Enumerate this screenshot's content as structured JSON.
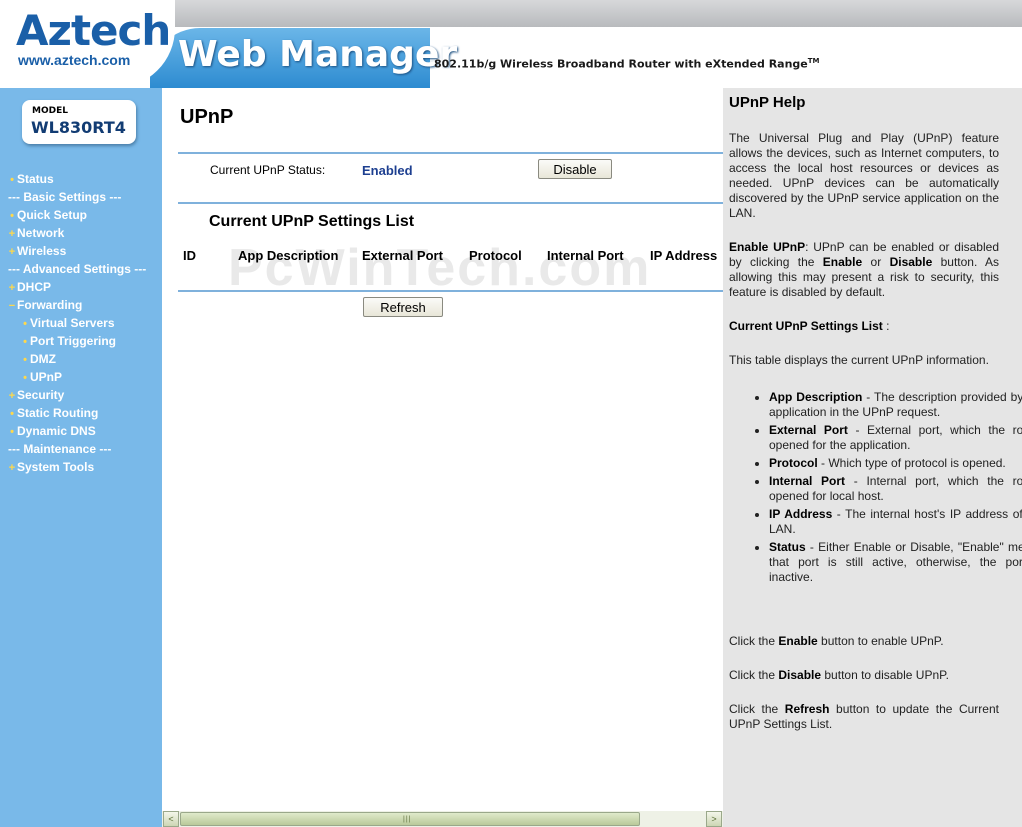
{
  "header": {
    "logo": "Aztech",
    "logo_url": "www.aztech.com",
    "title": "Web Manager",
    "subtitle": "802.11b/g Wireless Broadband Router with eXtended Range",
    "trademark": "TM"
  },
  "sidebar": {
    "model_label": "MODEL",
    "model_name": "WL830RT4",
    "items": [
      {
        "label": "Status",
        "bullet": "•",
        "level": "l1"
      },
      {
        "label": "--- Basic Settings ---",
        "bullet": "",
        "level": "sec"
      },
      {
        "label": "Quick Setup",
        "bullet": "•",
        "level": "l1"
      },
      {
        "label": "Network",
        "bullet": "+",
        "level": "l1"
      },
      {
        "label": "Wireless",
        "bullet": "+",
        "level": "l1"
      },
      {
        "label": "--- Advanced Settings ---",
        "bullet": "",
        "level": "sec"
      },
      {
        "label": "DHCP",
        "bullet": "+",
        "level": "l1"
      },
      {
        "label": "Forwarding",
        "bullet": "−",
        "level": "l1"
      },
      {
        "label": "Virtual Servers",
        "bullet": "•",
        "level": "l2"
      },
      {
        "label": "Port Triggering",
        "bullet": "•",
        "level": "l2"
      },
      {
        "label": "DMZ",
        "bullet": "•",
        "level": "l2"
      },
      {
        "label": "UPnP",
        "bullet": "•",
        "level": "l2"
      },
      {
        "label": "Security",
        "bullet": "+",
        "level": "l1"
      },
      {
        "label": "Static Routing",
        "bullet": "•",
        "level": "l1"
      },
      {
        "label": "Dynamic DNS",
        "bullet": "•",
        "level": "l1"
      },
      {
        "label": "--- Maintenance ---",
        "bullet": "",
        "level": "sec"
      },
      {
        "label": "System Tools",
        "bullet": "+",
        "level": "l1"
      }
    ]
  },
  "main": {
    "title": "UPnP",
    "status_label": "Current UPnP Status:",
    "status_value": "Enabled",
    "disable_button": "Disable",
    "list_title": "Current UPnP Settings List",
    "columns": [
      "ID",
      "App Description",
      "External Port",
      "Protocol",
      "Internal Port",
      "IP Address"
    ],
    "refresh_button": "Refresh",
    "watermark": "PcWinTech.com"
  },
  "help": {
    "title": "UPnP Help",
    "intro": "The Universal Plug and Play (UPnP) feature allows the devices, such as Internet computers, to access the local host resources or devices as needed. UPnP devices can be automatically discovered by the UPnP service application on the LAN.",
    "enable_term": "Enable UPnP",
    "enable_text_1": ": UPnP can be enabled or disabled by clicking the ",
    "enable_word": "Enable",
    "enable_text_2": " or ",
    "disable_word": "Disable",
    "enable_text_3": " button. As allowing this may present a risk to security, this feature is disabled by default.",
    "list_term": "Current UPnP Settings List",
    "list_suffix": " :",
    "table_desc": "This table displays the current UPnP information.",
    "bullets": [
      {
        "term": "App Description",
        "text": " - The description provided by the application in the UPnP request."
      },
      {
        "term": "External Port",
        "text": " - External port, which the router opened for the application."
      },
      {
        "term": "Protocol",
        "text": " - Which type of protocol is opened."
      },
      {
        "term": "Internal Port",
        "text": " - Internal port, which the router opened for local host."
      },
      {
        "term": "IP Address",
        "text": " - The internal host's IP address of the LAN."
      },
      {
        "term": "Status",
        "text": " - Either Enable or Disable, \"Enable\" means that port is still active, otherwise, the port is inactive."
      }
    ],
    "click_enable_1": "Click the ",
    "click_enable_word": "Enable",
    "click_enable_2": " button to enable UPnP.",
    "click_disable_1": "Click the ",
    "click_disable_word": "Disable",
    "click_disable_2": " button to disable UPnP.",
    "click_refresh_1": "Click the ",
    "click_refresh_word": "Refresh",
    "click_refresh_2": " button to update the Current UPnP Settings List."
  },
  "scrollbar": {
    "left_arrow": "<",
    "right_arrow": ">",
    "grip": "|||"
  }
}
